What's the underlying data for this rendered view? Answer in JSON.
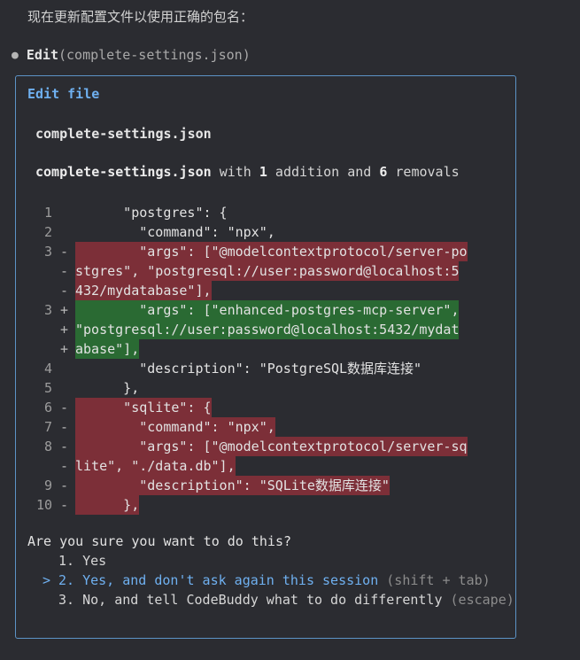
{
  "intro_text": "现在更新配置文件以使用正确的包名：",
  "tool_call": {
    "bullet": "●",
    "name": "Edit",
    "arg_open": "(",
    "arg": "complete-settings.json",
    "arg_close": ")"
  },
  "panel": {
    "title": "Edit file",
    "filename": "complete-settings.json",
    "summary": {
      "file": "complete-settings.json",
      "with": " with ",
      "additions": "1",
      "addition_word": " addition and ",
      "removals": "6",
      "removal_word": " removals"
    }
  },
  "diff_lines": [
    {
      "num": "1",
      "sign": "",
      "type": "context",
      "text": "      \"postgres\": {"
    },
    {
      "num": "2",
      "sign": "",
      "type": "context",
      "text": "        \"command\": \"npx\","
    },
    {
      "num": "3",
      "sign": "-",
      "type": "removed",
      "text": "        \"args\": [\"@modelcontextprotocol/server-po"
    },
    {
      "num": "",
      "sign": "-",
      "type": "removed",
      "text": "stgres\", \"postgresql://user:password@localhost:5"
    },
    {
      "num": "",
      "sign": "-",
      "type": "removed",
      "text": "432/mydatabase\"],"
    },
    {
      "num": "3",
      "sign": "+",
      "type": "added",
      "text": "        \"args\": [\"enhanced-postgres-mcp-server\","
    },
    {
      "num": "",
      "sign": "+",
      "type": "added",
      "text": "\"postgresql://user:password@localhost:5432/mydat"
    },
    {
      "num": "",
      "sign": "+",
      "type": "added",
      "text": "abase\"],"
    },
    {
      "num": "4",
      "sign": "",
      "type": "context",
      "text": "        \"description\": \"PostgreSQL数据库连接\""
    },
    {
      "num": "5",
      "sign": "",
      "type": "context",
      "text": "      },"
    },
    {
      "num": "6",
      "sign": "-",
      "type": "removed",
      "text": "      \"sqlite\": {"
    },
    {
      "num": "7",
      "sign": "-",
      "type": "removed",
      "text": "        \"command\": \"npx\","
    },
    {
      "num": "8",
      "sign": "-",
      "type": "removed",
      "text": "        \"args\": [\"@modelcontextprotocol/server-sq"
    },
    {
      "num": "",
      "sign": "-",
      "type": "removed",
      "text": "lite\", \"./data.db\"],"
    },
    {
      "num": "9",
      "sign": "-",
      "type": "removed",
      "text": "        \"description\": \"SQLite数据库连接\""
    },
    {
      "num": "10",
      "sign": "-",
      "type": "removed",
      "text": "      },"
    }
  ],
  "prompt": {
    "question": "Are you sure you want to do this?",
    "options": [
      {
        "caret": "",
        "label": "1. Yes",
        "hint": ""
      },
      {
        "caret": ">",
        "label": "2. Yes, and don't ask again this session",
        "hint": " (shift + tab)"
      },
      {
        "caret": "",
        "label": "3. No, and tell CodeBuddy what to do differently",
        "hint": " (escape)"
      }
    ],
    "selected_index": 1
  },
  "colors": {
    "background": "#2b2c31",
    "accent": "#6fb0f0",
    "panel_border": "#5c93c6",
    "removed_bg": "#7c2f38",
    "added_bg": "#2a6a33"
  }
}
